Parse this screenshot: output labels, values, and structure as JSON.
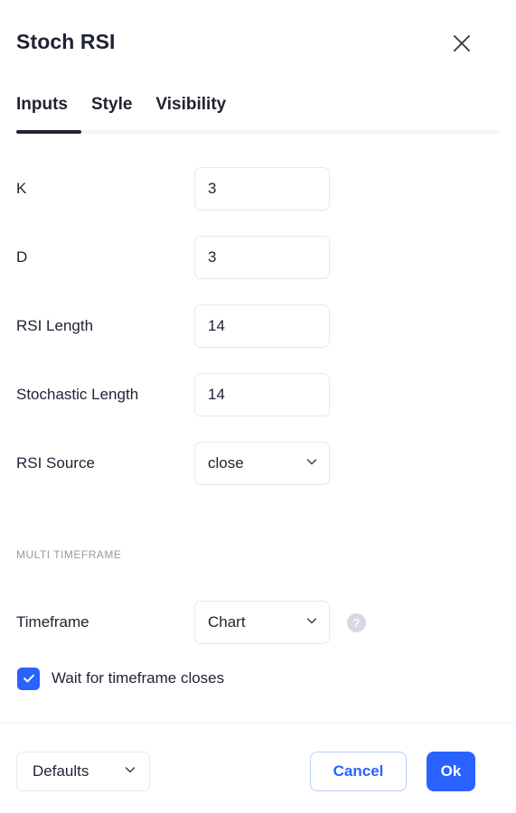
{
  "dialog": {
    "title": "Stoch RSI",
    "close_icon": "close-icon"
  },
  "tabs": {
    "items": [
      {
        "label": "Inputs",
        "active": true
      },
      {
        "label": "Style",
        "active": false
      },
      {
        "label": "Visibility",
        "active": false
      }
    ]
  },
  "inputs": {
    "rows": [
      {
        "label": "K",
        "value": "3",
        "type": "text"
      },
      {
        "label": "D",
        "value": "3",
        "type": "text"
      },
      {
        "label": "RSI Length",
        "value": "14",
        "type": "text"
      },
      {
        "label": "Stochastic Length",
        "value": "14",
        "type": "text"
      },
      {
        "label": "RSI Source",
        "value": "close",
        "type": "select"
      }
    ]
  },
  "multi_timeframe": {
    "section_label": "MULTI TIMEFRAME",
    "timeframe": {
      "label": "Timeframe",
      "value": "Chart",
      "help_icon": "help-icon",
      "help_glyph": "?"
    },
    "wait_checkbox": {
      "label": "Wait for timeframe closes",
      "checked": true
    }
  },
  "footer": {
    "defaults_label": "Defaults",
    "cancel_label": "Cancel",
    "ok_label": "Ok"
  },
  "colors": {
    "accent": "#2962ff",
    "title": "#1f2233",
    "border": "#e7e9ef",
    "muted": "#9598a1",
    "track": "#f0f3fa"
  }
}
